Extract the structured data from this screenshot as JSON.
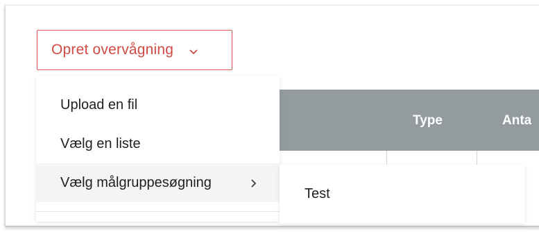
{
  "trigger": {
    "label": "Opret overvågning",
    "chevron_icon": "chevron-down-icon"
  },
  "menu": {
    "items": [
      {
        "label": "Upload en fil"
      },
      {
        "label": "Vælg en liste"
      },
      {
        "label": "Vælg målgruppesøgning",
        "icon": "chevron-right-icon",
        "active": true
      }
    ]
  },
  "submenu": {
    "items": [
      {
        "label": "Test"
      }
    ]
  },
  "table": {
    "columns": [
      "Type",
      "Anta"
    ]
  },
  "colors": {
    "accent": "#cf4a43",
    "table_header": "#939b9f",
    "active_item_bg": "#f4f4f4"
  }
}
